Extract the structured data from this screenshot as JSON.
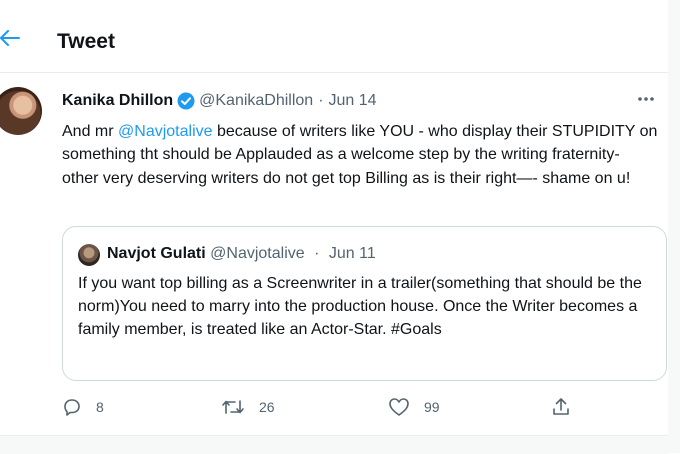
{
  "header": {
    "title": "Tweet"
  },
  "tweet": {
    "author_name": "Kanika Dhillon",
    "handle": "@KanikaDhillon",
    "separator": "·",
    "date": "Jun 14",
    "more": "•••",
    "text_prefix": "And mr ",
    "mention": "@Navjotalive",
    "text_suffix": " because of writers like YOU - who display their STUPIDITY on something tht should be Applauded as a welcome step by the writing fraternity- other very deserving writers do not get top Billing as is their right—- shame on u!"
  },
  "quoted_tweet": {
    "author_name": "Navjot Gulati",
    "handle": "@Navjotalive",
    "separator": "·",
    "date": "Jun 11",
    "text": "If you want top billing as a Screenwriter in a trailer(something that should be the norm)You need to marry into the production house. Once the Writer becomes a family member, is treated like an Actor-Star. #Goals"
  },
  "actions": {
    "replies": "8",
    "retweets": "26",
    "likes": "99"
  },
  "colors": {
    "accent": "#1d9bf0",
    "secondary_text": "#536471",
    "border": "#cfd9de"
  }
}
